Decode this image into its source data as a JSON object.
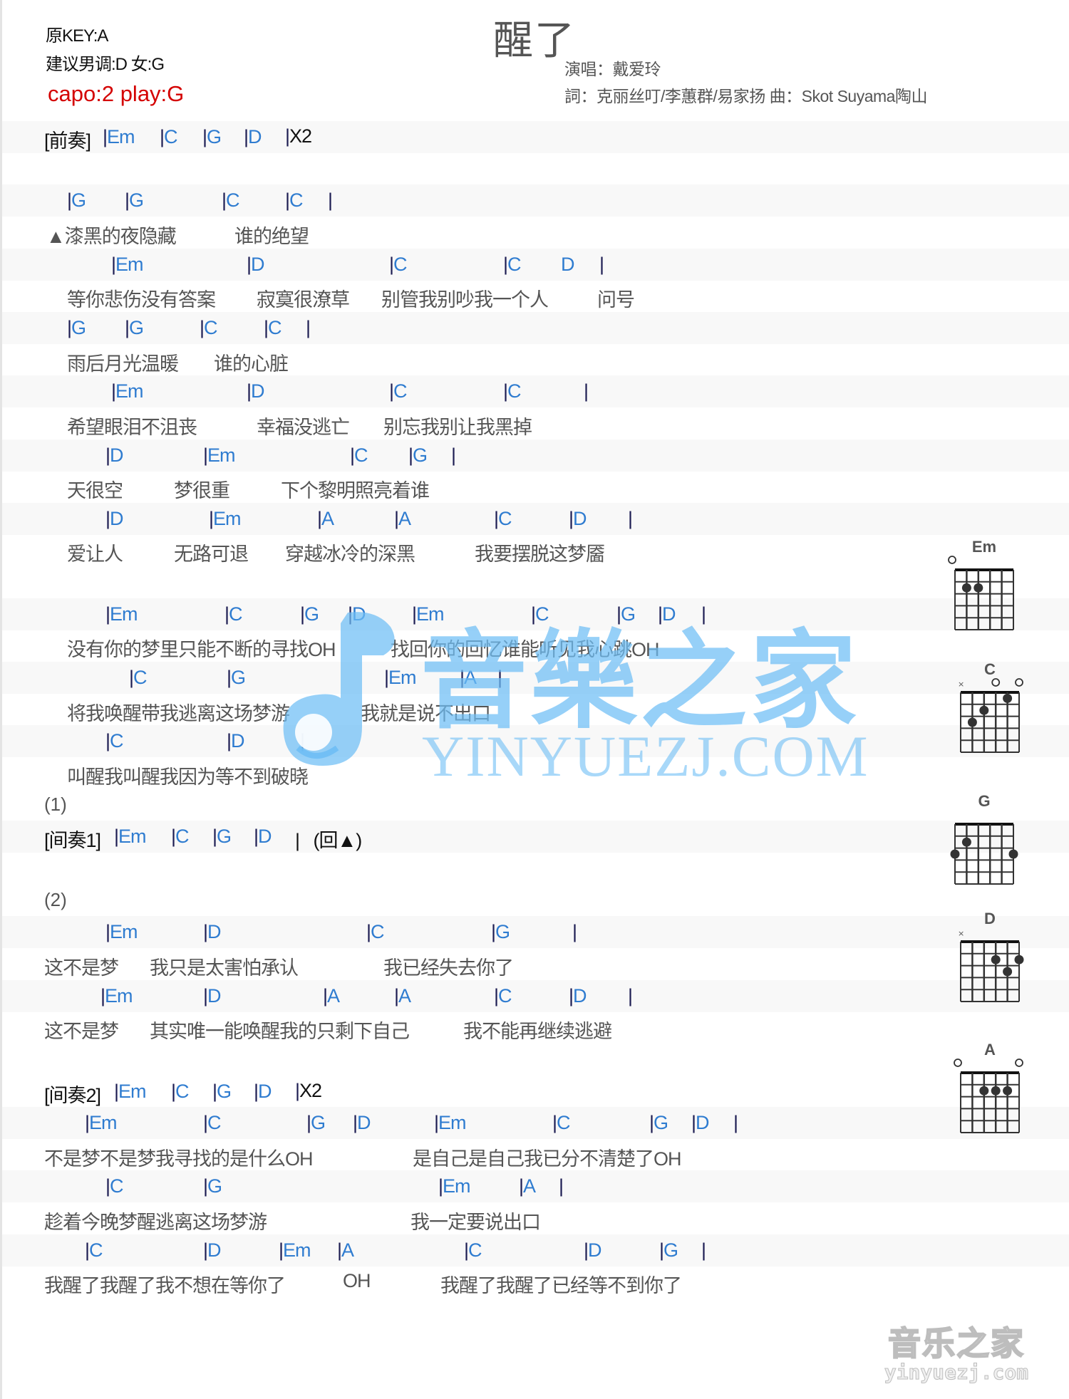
{
  "header": {
    "original_key": "原KEY:A",
    "suggested_key": "建议男调:D 女:G",
    "capo": "capo:2 play:G",
    "title": "醒了",
    "singer": "演唱：戴爱玲",
    "credits": "詞：克丽丝叮/李蕙群/易家扬   曲：Skot Suyama陶山"
  },
  "colors": {
    "chord": "#2f7cd0",
    "bar": "#1c1c52",
    "lyric": "#555555",
    "capo": "#d40000",
    "band": "#f8f8f8"
  },
  "sheet": [
    {
      "type": "intro",
      "label": "[前奏]",
      "chords": [
        "Em",
        "C",
        "G",
        "D"
      ],
      "suffix": "X2"
    },
    {
      "type": "blank"
    },
    {
      "type": "chords",
      "chords": [
        "G",
        "G",
        "C",
        "C"
      ],
      "end": "|"
    },
    {
      "type": "lyrics",
      "segments": [
        "▲漆黑的夜隐藏",
        "谁的绝望"
      ]
    },
    {
      "type": "chords",
      "chords": [
        "Em",
        "D",
        "C",
        "C",
        "D"
      ],
      "end": "|"
    },
    {
      "type": "lyrics",
      "segments": [
        "等你悲伤没有答案",
        "寂寞很潦草",
        "别管我别吵我一个人",
        "问号"
      ]
    },
    {
      "type": "chords",
      "chords": [
        "G",
        "G",
        "C",
        "C"
      ],
      "end": "|"
    },
    {
      "type": "lyrics",
      "segments": [
        "雨后月光温暖",
        "谁的心脏"
      ]
    },
    {
      "type": "chords",
      "chords": [
        "Em",
        "D",
        "C",
        "C"
      ],
      "end": "|"
    },
    {
      "type": "lyrics",
      "segments": [
        "希望眼泪不沮丧",
        "幸福没逃亡",
        "别忘我别让我黑掉"
      ]
    },
    {
      "type": "chords",
      "chords": [
        "D",
        "Em",
        "C",
        "G"
      ],
      "end": "|"
    },
    {
      "type": "lyrics",
      "segments": [
        "天很空",
        "梦很重",
        "下个黎明照亮着谁"
      ]
    },
    {
      "type": "chords",
      "chords": [
        "D",
        "Em",
        "A",
        "A",
        "C",
        "D"
      ],
      "end": "|"
    },
    {
      "type": "lyrics",
      "segments": [
        "爱让人",
        "无路可退",
        "穿越冰冷的深黑",
        "我要摆脱这梦靥"
      ]
    },
    {
      "type": "blank"
    },
    {
      "type": "chords",
      "chords": [
        "Em",
        "C",
        "G",
        "D",
        "Em",
        "C",
        "G",
        "D"
      ],
      "end": "|"
    },
    {
      "type": "lyrics",
      "segments": [
        "没有你的梦里只能不断的寻找OH",
        "找回你的回忆谁能听见我心跳OH"
      ]
    },
    {
      "type": "chords",
      "chords": [
        "C",
        "G",
        "Em",
        "A"
      ],
      "end": "|"
    },
    {
      "type": "lyrics",
      "segments": [
        "将我唤醒带我逃离这场梦游",
        "我就是说不出口"
      ]
    },
    {
      "type": "chords",
      "chords": [
        "C",
        "D"
      ],
      "end": "|"
    },
    {
      "type": "lyrics",
      "segments": [
        "叫醒我叫醒我因为等不到破晓"
      ]
    },
    {
      "type": "mark",
      "text": "(1)"
    },
    {
      "type": "intro",
      "label": "[间奏1]",
      "chords": [
        "Em",
        "C",
        "G",
        "D"
      ],
      "suffix": "|   (回▲)"
    },
    {
      "type": "blank"
    },
    {
      "type": "mark",
      "text": "(2)"
    },
    {
      "type": "chords",
      "chords": [
        "Em",
        "D",
        "C",
        "G"
      ],
      "end": "|"
    },
    {
      "type": "lyrics",
      "segments": [
        "这不是梦",
        "我只是太害怕承认",
        "我已经失去你了"
      ]
    },
    {
      "type": "chords",
      "chords": [
        "Em",
        "D",
        "A",
        "A",
        "C",
        "D"
      ],
      "end": "|"
    },
    {
      "type": "lyrics",
      "segments": [
        "这不是梦",
        "其实唯一能唤醒我的只剩下自己",
        "我不能再继续逃避"
      ]
    },
    {
      "type": "blank"
    },
    {
      "type": "intro",
      "label": "[间奏2]",
      "chords": [
        "Em",
        "C",
        "G",
        "D"
      ],
      "suffix": "X2"
    },
    {
      "type": "chords",
      "chords": [
        "Em",
        "C",
        "G",
        "D",
        "Em",
        "C",
        "G",
        "D"
      ],
      "end": "|"
    },
    {
      "type": "lyrics",
      "segments": [
        "不是梦不是梦我寻找的是什么OH",
        "是自己是自己我已分不清楚了OH"
      ]
    },
    {
      "type": "chords",
      "chords": [
        "C",
        "G",
        "Em",
        "A"
      ],
      "end": "|"
    },
    {
      "type": "lyrics",
      "segments": [
        "趁着今晚梦醒逃离这场梦游",
        "我一定要说出口"
      ]
    },
    {
      "type": "chords",
      "chords": [
        "C",
        "D",
        "Em",
        "A",
        "C",
        "D",
        "G"
      ],
      "end": "|"
    },
    {
      "type": "lyrics",
      "segments": [
        "我醒了我醒了我不想在等你了",
        "OH",
        "我醒了我醒了已经等不到你了"
      ]
    }
  ],
  "chord_diagrams": [
    {
      "name": "Em",
      "strings": [
        "o",
        "",
        "",
        "",
        "",
        ""
      ],
      "dots": [
        [
          1,
          2
        ],
        [
          2,
          2
        ]
      ]
    },
    {
      "name": "C",
      "strings": [
        "x",
        "",
        "",
        "o",
        "",
        "o"
      ],
      "dots": [
        [
          4,
          1
        ],
        [
          2,
          2
        ],
        [
          1,
          3
        ]
      ]
    },
    {
      "name": "G",
      "strings": [
        "",
        "",
        "",
        "",
        "",
        ""
      ],
      "dots": [
        [
          1,
          2
        ],
        [
          0,
          3
        ],
        [
          5,
          3
        ]
      ]
    },
    {
      "name": "D",
      "strings": [
        "x",
        "",
        "",
        "",
        "",
        ""
      ],
      "dots": [
        [
          3,
          2
        ],
        [
          5,
          2
        ],
        [
          4,
          3
        ]
      ]
    },
    {
      "name": "A",
      "strings": [
        "o",
        "",
        "",
        "",
        "",
        "o"
      ],
      "dots": [
        [
          2,
          2
        ],
        [
          3,
          2
        ],
        [
          4,
          2
        ]
      ]
    }
  ],
  "watermark": {
    "cn": "音樂之家",
    "en": "YINYUEZJ.COM",
    "corner_cn": "音乐之家",
    "corner_en": "yinyuezj.com"
  }
}
